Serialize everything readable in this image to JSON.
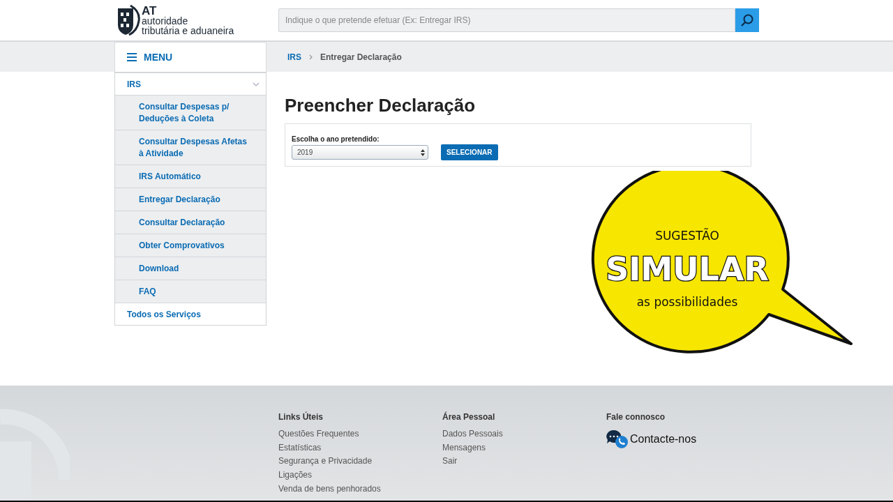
{
  "logo": {
    "abbr": "AT",
    "line1": "autoridade",
    "line2": "tributária e aduaneira"
  },
  "search": {
    "placeholder": "Indique o que pretende efetuar (Ex: Entregar IRS)"
  },
  "menu": {
    "label": "MENU"
  },
  "breadcrumb": [
    {
      "label": "IRS",
      "kind": "link"
    },
    {
      "label": "Entregar Declaração",
      "kind": "current"
    }
  ],
  "sidebar": {
    "items": [
      {
        "label": "IRS",
        "expanded": true,
        "children": [
          {
            "label": "Consultar Despesas p/ Deduções à Coleta"
          },
          {
            "label": "Consultar Despesas Afetas à Atividade"
          },
          {
            "label": "IRS Automático"
          },
          {
            "label": "Entregar Declaração"
          },
          {
            "label": "Consultar Declaração"
          },
          {
            "label": "Obter Comprovativos"
          },
          {
            "label": "Download"
          },
          {
            "label": "FAQ"
          }
        ]
      },
      {
        "label": "Todos os Serviços"
      }
    ]
  },
  "page_title": "Preencher Declaração",
  "form": {
    "label": "Escolha o ano pretendido:",
    "year_value": "2019",
    "button": "SELECIONAR"
  },
  "bubble": {
    "top": "SUGESTÃO",
    "main": "SIMULAR",
    "bottom": "as possibilidades"
  },
  "footer": {
    "columns": [
      {
        "title": "Links Úteis",
        "links": [
          "Questões Frequentes",
          "Estatísticas",
          "Segurança e Privacidade",
          "Ligações",
          "Venda de bens penhorados"
        ]
      },
      {
        "title": "Área Pessoal",
        "links": [
          "Dados Pessoais",
          "Mensagens",
          "Sair"
        ]
      },
      {
        "title": "Fale connosco",
        "contact": "Contacte-nos"
      }
    ]
  }
}
